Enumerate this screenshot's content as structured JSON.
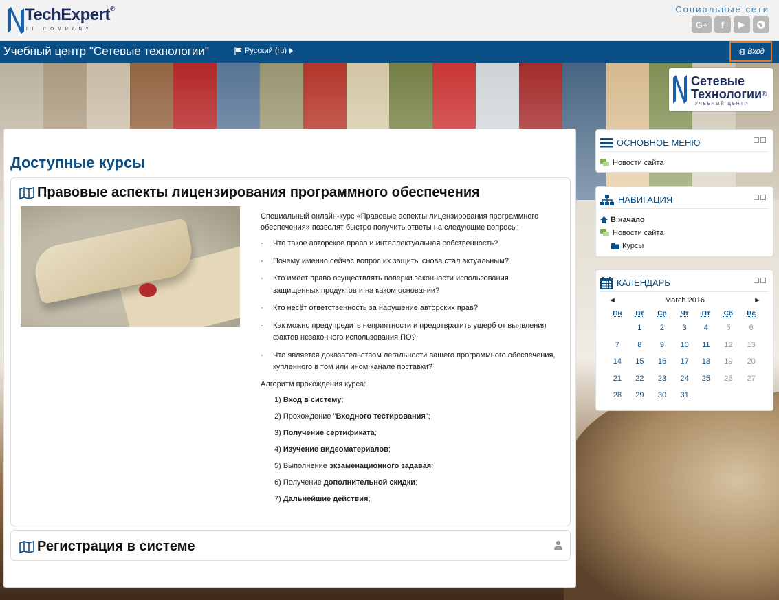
{
  "header": {
    "logo_text": "TechExpert",
    "logo_reg": "®",
    "logo_sub": "IT COMPANY",
    "social_title": "Социальные сети",
    "social_icons": [
      "google-plus-icon",
      "facebook-icon",
      "youtube-icon",
      "globe-icon"
    ],
    "social_labels": {
      "gp": "G+",
      "fb": "f",
      "yt": "▶"
    }
  },
  "navbar": {
    "site_name": "Учебный центр \"Сетевые технологии\"",
    "language": "Русский (ru)",
    "login_label": "Вход"
  },
  "brand_badge": {
    "line1": "Сетевые",
    "line2": "Технологии",
    "reg": "®",
    "line3": "УЧЕБНЫЙ ЦЕНТР"
  },
  "main": {
    "heading": "Доступные курсы",
    "courses": [
      {
        "title": "Правовые аспекты лицензирования программного обеспечения",
        "intro": "Специальный онлайн-курс «Правовые аспекты лицензирования программного обеспечения» позволят быстро получить ответы на следующие вопросы:",
        "questions": [
          "Что такое авторское право и интеллектуальная собственность?",
          "Почему именно сейчас вопрос их защиты снова стал актуальным?",
          "Кто имеет право осуществлять поверки законности использования защищенных продуктов и на каком основании?",
          "Кто несёт ответственность за нарушение авторских прав?",
          "Как можно предупредить неприятности и предотвратить ущерб от выявления фактов незаконного использования ПО?",
          "Что является доказательством легальности вашего программного обеспечения, купленного в том или ином канале поставки?"
        ],
        "algo_title": "Алгоритм прохождения курса:",
        "steps": [
          {
            "num": "1)",
            "pre": "",
            "bold": "Вход в систему",
            "post": ";"
          },
          {
            "num": "2)",
            "pre": "Прохождение \"",
            "bold": "Входного тестирования",
            "post": "\";"
          },
          {
            "num": "3)",
            "pre": "",
            "bold": "Получение сертификата",
            "post": ";"
          },
          {
            "num": "4)",
            "pre": "",
            "bold": "Изучение видеоматериалов",
            "post": ";"
          },
          {
            "num": "5)",
            "pre": "Выполнение ",
            "bold": "экзаменационного задавая",
            "post": ";"
          },
          {
            "num": "6)",
            "pre": "Получение ",
            "bold": "дополнительной скидки",
            "post": ";"
          },
          {
            "num": "7)",
            "pre": "",
            "bold": "Дальнейшие действия",
            "post": ";"
          }
        ]
      },
      {
        "title": "Регистрация в системе"
      }
    ]
  },
  "blocks": {
    "main_menu": {
      "title": "ОСНОВНОЕ МЕНЮ",
      "items": [
        "Новости сайта"
      ]
    },
    "navigation": {
      "title": "НАВИГАЦИЯ",
      "home": "В начало",
      "news": "Новости сайта",
      "courses": "Курсы"
    },
    "calendar": {
      "title": "КАЛЕНДАРЬ",
      "month": "March 2016",
      "prev": "◄",
      "next": "►",
      "weekdays": [
        "Пн",
        "Вт",
        "Ср",
        "Чт",
        "Пт",
        "Сб",
        "Вс"
      ],
      "weeks": [
        [
          "",
          "1",
          "2",
          "3",
          "4",
          "5",
          "6"
        ],
        [
          "7",
          "8",
          "9",
          "10",
          "11",
          "12",
          "13"
        ],
        [
          "14",
          "15",
          "16",
          "17",
          "18",
          "19",
          "20"
        ],
        [
          "21",
          "22",
          "23",
          "24",
          "25",
          "26",
          "27"
        ],
        [
          "28",
          "29",
          "30",
          "31",
          "",
          "",
          ""
        ]
      ]
    }
  },
  "colors": {
    "brand": "#0b4f87",
    "accent": "#e07a2e"
  }
}
